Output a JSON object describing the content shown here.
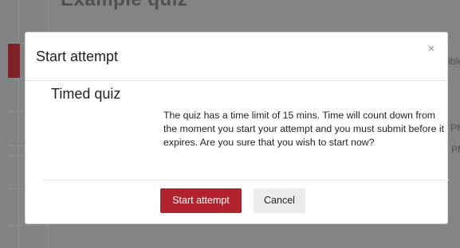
{
  "background": {
    "page_title": "Example quiz",
    "fragment_1": "ible",
    "fragment_2": "PM",
    "fragment_3": "PM"
  },
  "modal": {
    "title": "Start attempt",
    "close_label": "×",
    "heading": "Timed quiz",
    "message": "The quiz has a time limit of 15 mins. Time will count down from the moment you start your attempt and you must submit before it expires. Are you sure that you wish to start now?",
    "primary_label": "Start attempt",
    "secondary_label": "Cancel"
  },
  "colors": {
    "primary": "#b1232d",
    "backdrop": "#838486",
    "secondary": "#ececec"
  }
}
